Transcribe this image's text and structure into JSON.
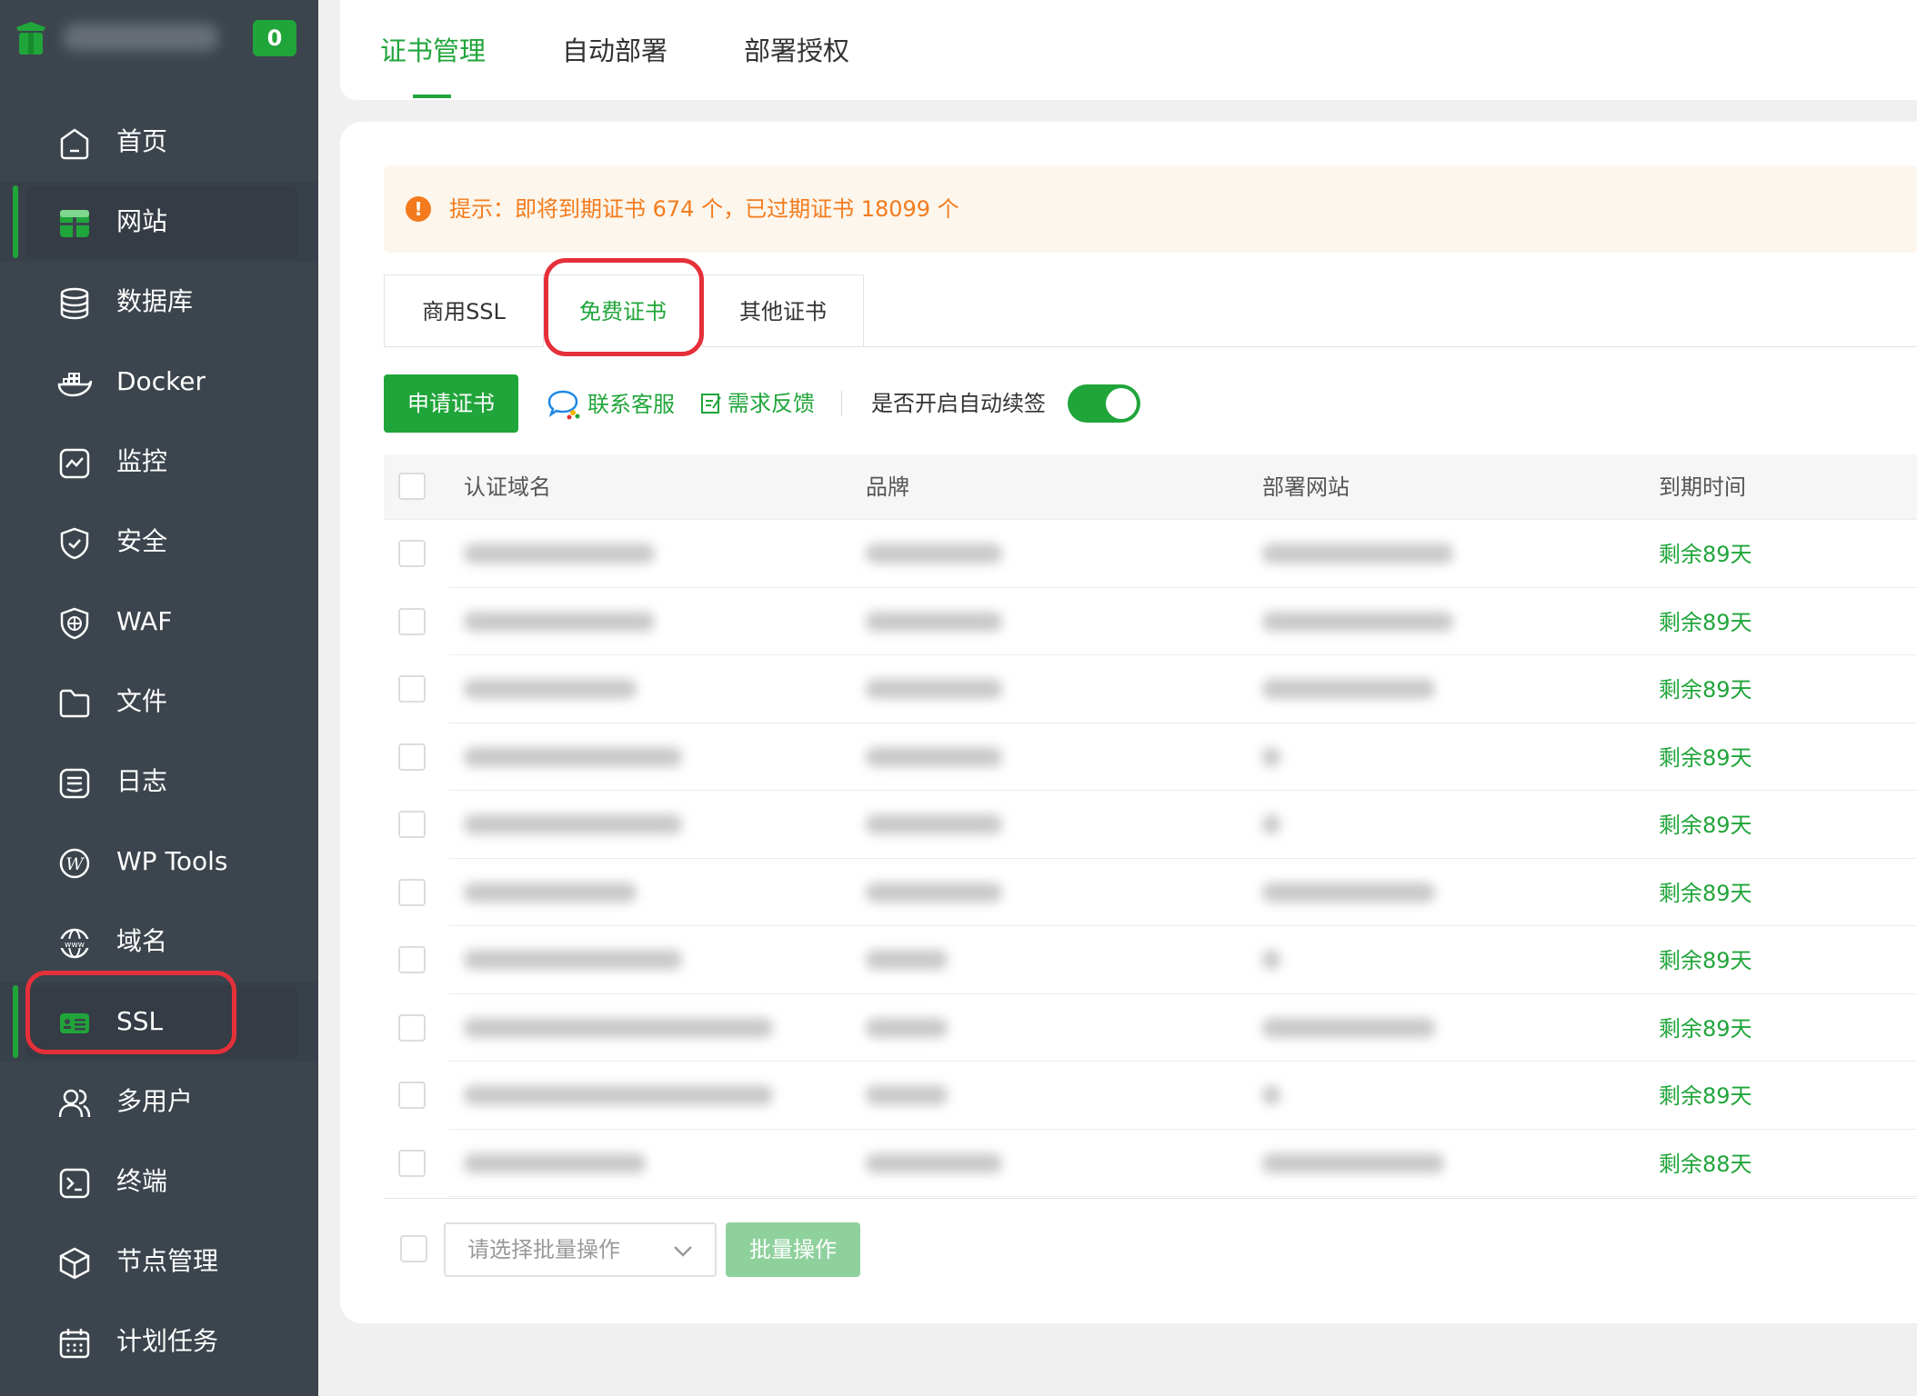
{
  "sidebar": {
    "badge": "0",
    "items": [
      {
        "label": "首页",
        "icon": "home-icon"
      },
      {
        "label": "网站",
        "icon": "website-icon"
      },
      {
        "label": "数据库",
        "icon": "database-icon"
      },
      {
        "label": "Docker",
        "icon": "docker-icon"
      },
      {
        "label": "监控",
        "icon": "monitor-icon"
      },
      {
        "label": "安全",
        "icon": "shield-icon"
      },
      {
        "label": "WAF",
        "icon": "waf-icon"
      },
      {
        "label": "文件",
        "icon": "folder-icon"
      },
      {
        "label": "日志",
        "icon": "log-icon"
      },
      {
        "label": "WP Tools",
        "icon": "wordpress-icon"
      },
      {
        "label": "域名",
        "icon": "globe-icon"
      },
      {
        "label": "SSL",
        "icon": "ssl-icon"
      },
      {
        "label": "多用户",
        "icon": "users-icon"
      },
      {
        "label": "终端",
        "icon": "terminal-icon"
      },
      {
        "label": "节点管理",
        "icon": "node-icon"
      },
      {
        "label": "计划任务",
        "icon": "calendar-icon"
      }
    ]
  },
  "top_tabs": [
    "证书管理",
    "自动部署",
    "部署授权"
  ],
  "notice": "提示：即将到期证书 674 个，已过期证书 18099 个",
  "sub_tabs": [
    "商用SSL",
    "免费证书",
    "其他证书"
  ],
  "toolbar": {
    "apply": "申请证书",
    "contact": "联系客服",
    "feedback": "需求反馈",
    "auto_renew": "是否开启自动续签"
  },
  "table": {
    "headers": [
      "认证域名",
      "品牌",
      "部署网站",
      "到期时间"
    ],
    "rows": [
      {
        "expire": "剩余89天"
      },
      {
        "expire": "剩余89天"
      },
      {
        "expire": "剩余89天"
      },
      {
        "expire": "剩余89天"
      },
      {
        "expire": "剩余89天"
      },
      {
        "expire": "剩余89天"
      },
      {
        "expire": "剩余89天"
      },
      {
        "expire": "剩余89天"
      },
      {
        "expire": "剩余89天"
      },
      {
        "expire": "剩余88天"
      }
    ]
  },
  "footer": {
    "select_placeholder": "请选择批量操作",
    "batch": "批量操作"
  },
  "colors": {
    "accent": "#20a53a",
    "sidebar": "#3c444d",
    "warning": "#f37b1d",
    "highlight": "#e5303a"
  }
}
